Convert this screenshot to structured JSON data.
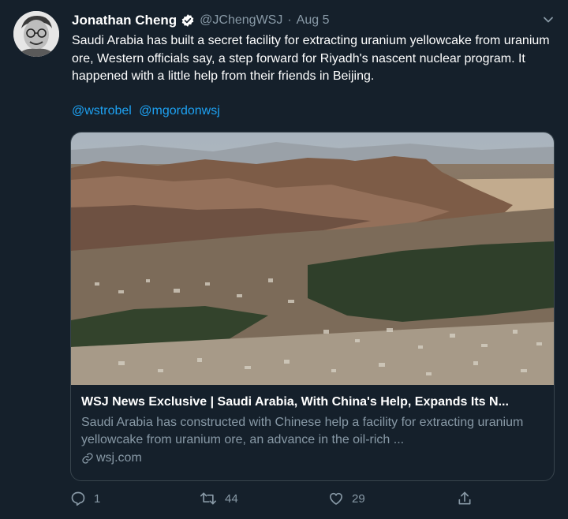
{
  "tweet": {
    "author_name": "Jonathan Cheng",
    "handle": "@JChengWSJ",
    "separator": "·",
    "date": "Aug 5",
    "text": "Saudi Arabia has built a secret facility for extracting uranium yellowcake from uranium ore, Western officials say, a step forward for Riyadh's nascent nuclear program. It happened with a little help from their friends in Beijing.",
    "mentions": [
      "@wstrobel",
      "@mgordonwsj"
    ]
  },
  "card": {
    "title": "WSJ News Exclusive | Saudi Arabia, With China's Help, Expands Its N...",
    "description": "Saudi Arabia has constructed with Chinese help a facility for extracting uranium yellowcake from uranium ore, an advance in the oil-rich ...",
    "domain": "wsj.com"
  },
  "actions": {
    "replies": "1",
    "retweets": "44",
    "likes": "29"
  },
  "icons": [
    "verified-badge-icon",
    "chevron-down-icon",
    "link-icon",
    "reply-icon",
    "retweet-icon",
    "like-icon",
    "share-icon"
  ],
  "colors": {
    "background": "#15202b",
    "secondary_text": "#8899a6",
    "link": "#1da1f2",
    "border": "#38444d"
  }
}
